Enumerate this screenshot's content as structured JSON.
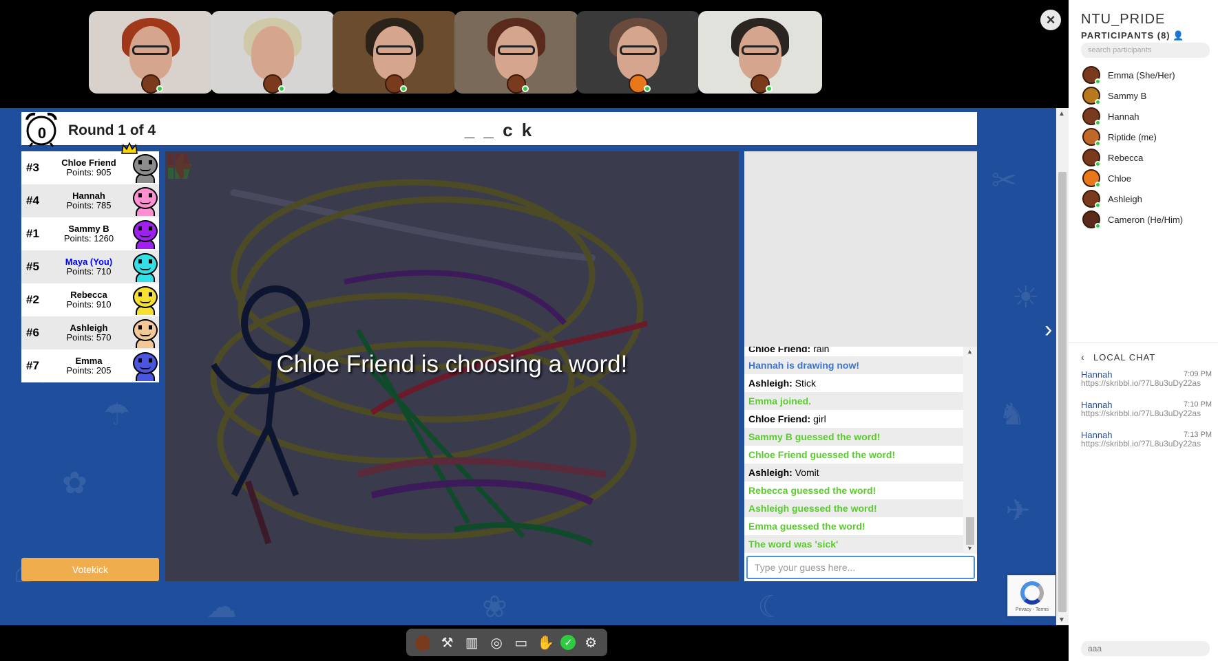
{
  "video_tiles": [
    {
      "hair": "#a0391a",
      "bg": "#d9d2cc"
    },
    {
      "hair": "#cfc9a8",
      "bg": "#d7d5d3"
    },
    {
      "hair": "#2b2219",
      "bg": "#6b4c2e"
    },
    {
      "hair": "#5a2b1c",
      "bg": "#7a6a5a"
    },
    {
      "hair": "#6a4a3a",
      "bg": "#3a3a3a"
    },
    {
      "hair": "#2a2520",
      "bg": "#e2e2dc"
    }
  ],
  "close_label": "×",
  "header": {
    "timer": "0",
    "round_text": "Round 1 of 4",
    "word_hint": "_ _ c k"
  },
  "players": [
    {
      "rank": "#3",
      "name": "Chloe Friend",
      "points": "Points: 905",
      "color": "#8c8c8c",
      "you": false
    },
    {
      "rank": "#4",
      "name": "Hannah",
      "points": "Points: 785",
      "color": "#ff8fd1",
      "you": false
    },
    {
      "rank": "#1",
      "name": "Sammy B",
      "points": "Points: 1260",
      "color": "#a020f0",
      "you": false
    },
    {
      "rank": "#5",
      "name": "Maya (You)",
      "points": "Points: 710",
      "color": "#33e0e6",
      "you": true
    },
    {
      "rank": "#2",
      "name": "Rebecca",
      "points": "Points: 910",
      "color": "#f5e031",
      "you": false
    },
    {
      "rank": "#6",
      "name": "Ashleigh",
      "points": "Points: 570",
      "color": "#f3c896",
      "you": false
    },
    {
      "rank": "#7",
      "name": "Emma",
      "points": "Points: 205",
      "color": "#4a55e0",
      "you": false
    }
  ],
  "votekick_label": "Votekick",
  "canvas": {
    "overlay_text": "Chloe Friend is choosing a word!"
  },
  "chat": {
    "lines": [
      {
        "type": "normal",
        "who": "Chloe Friend:",
        "text": " rain"
      },
      {
        "type": "blue",
        "text": "Hannah is drawing now!"
      },
      {
        "type": "normal",
        "who": "Ashleigh:",
        "text": " Stick"
      },
      {
        "type": "green",
        "text": "Emma joined."
      },
      {
        "type": "normal",
        "who": "Chloe Friend:",
        "text": " girl"
      },
      {
        "type": "green",
        "text": "Sammy B guessed the word!"
      },
      {
        "type": "green",
        "text": "Chloe Friend guessed the word!"
      },
      {
        "type": "normal",
        "who": "Ashleigh:",
        "text": " Vomit"
      },
      {
        "type": "green",
        "text": "Rebecca guessed the word!"
      },
      {
        "type": "green",
        "text": "Ashleigh guessed the word!"
      },
      {
        "type": "green",
        "text": "Emma guessed the word!"
      },
      {
        "type": "green",
        "text": "The word was 'sick'"
      }
    ],
    "input_placeholder": "Type your guess here..."
  },
  "recaptcha_label": "Privacy - Terms",
  "sidebar": {
    "room_name": "NTU_PRIDE",
    "participants_title": "PARTICIPANTS (8)",
    "search_placeholder": "search participants",
    "participants": [
      "Emma (She/Her)",
      "Sammy B",
      "Hannah",
      "Riptide (me)",
      "Rebecca",
      "Chloe",
      "Ashleigh",
      "Cameron (He/Him)"
    ],
    "local_chat_title": "LOCAL CHAT",
    "messages": [
      {
        "author": "Hannah",
        "time": "7:09 PM",
        "text": "https://skribbl.io/?7L8u3uDy22as"
      },
      {
        "author": "Hannah",
        "time": "7:10 PM",
        "text": "https://skribbl.io/?7L8u3uDy22as"
      },
      {
        "author": "Hannah",
        "time": "7:13 PM",
        "text": "https://skribbl.io/?7L8u3uDy22as"
      }
    ],
    "local_chat_input_value": "aaa"
  },
  "toolbar_icons": [
    "avatar-icon",
    "hammer-icon",
    "map-icon",
    "target-icon",
    "screen-share-icon",
    "raise-hand-icon",
    "check-icon",
    "settings-icon"
  ]
}
